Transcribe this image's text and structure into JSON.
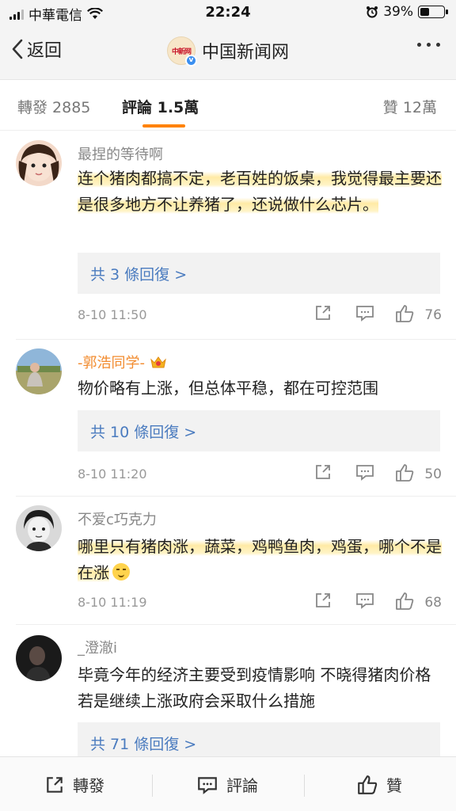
{
  "status_bar": {
    "carrier": "中華電信",
    "time": "22:24",
    "battery": "39%",
    "battery_level": 0.39
  },
  "nav": {
    "back_label": "返回",
    "logo_text": "中新网",
    "account_name": "中国新闻网"
  },
  "tabs": {
    "repost": "轉發 2885",
    "comments": "評論 1.5萬",
    "likes": "贊 12萬"
  },
  "comments": [
    {
      "user": "最捏的等待啊",
      "text": "连个猪肉都搞不定，老百姓的饭桌，我觉得最主要还是很多地方不让养猪了，还说做什么芯片。",
      "replies": "共 3 條回復 >",
      "time": "8-10 11:50",
      "likes": "76"
    },
    {
      "user": "-郭浩同学-",
      "text": "物价略有上涨，但总体平稳，都在可控范围",
      "replies": "共 10 條回復 >",
      "time": "8-10 11:20",
      "likes": "50"
    },
    {
      "user": "不爱c巧克力",
      "text": "哪里只有猪肉涨，蔬菜，鸡鸭鱼肉，鸡蛋，哪个不是在涨",
      "time": "8-10 11:19",
      "likes": "68"
    },
    {
      "user": "_澄澈i",
      "text": "毕竟今年的经济主要受到疫情影响 不晓得猪肉价格若是继续上涨政府会采取什么措施",
      "replies": "共 71 條回復 >"
    }
  ],
  "bottom_bar": {
    "repost": "轉發",
    "comment": "評論",
    "like": "贊"
  },
  "colors": {
    "accent": "#ff8200",
    "link": "#4a7bbf",
    "vip_name": "#f28b2e"
  }
}
